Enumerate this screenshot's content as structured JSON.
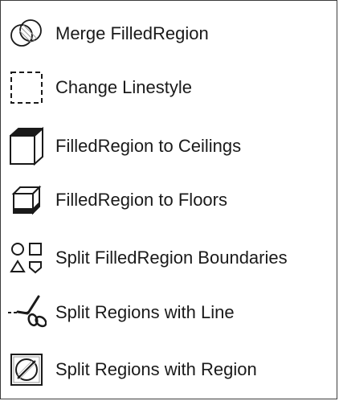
{
  "menu": {
    "items": [
      {
        "label": "Merge FilledRegion",
        "icon": "merge-circles-icon"
      },
      {
        "label": "Change Linestyle",
        "icon": "dashed-rectangle-icon"
      },
      {
        "label": "FilledRegion to Ceilings",
        "icon": "ceiling-cube-icon"
      },
      {
        "label": "FilledRegion to Floors",
        "icon": "floor-cube-icon"
      },
      {
        "label": "Split FilledRegion Boundaries",
        "icon": "split-shapes-icon"
      },
      {
        "label": "Split Regions with Line",
        "icon": "scissors-icon"
      },
      {
        "label": "Split Regions with Region",
        "icon": "split-region-icon"
      }
    ]
  }
}
